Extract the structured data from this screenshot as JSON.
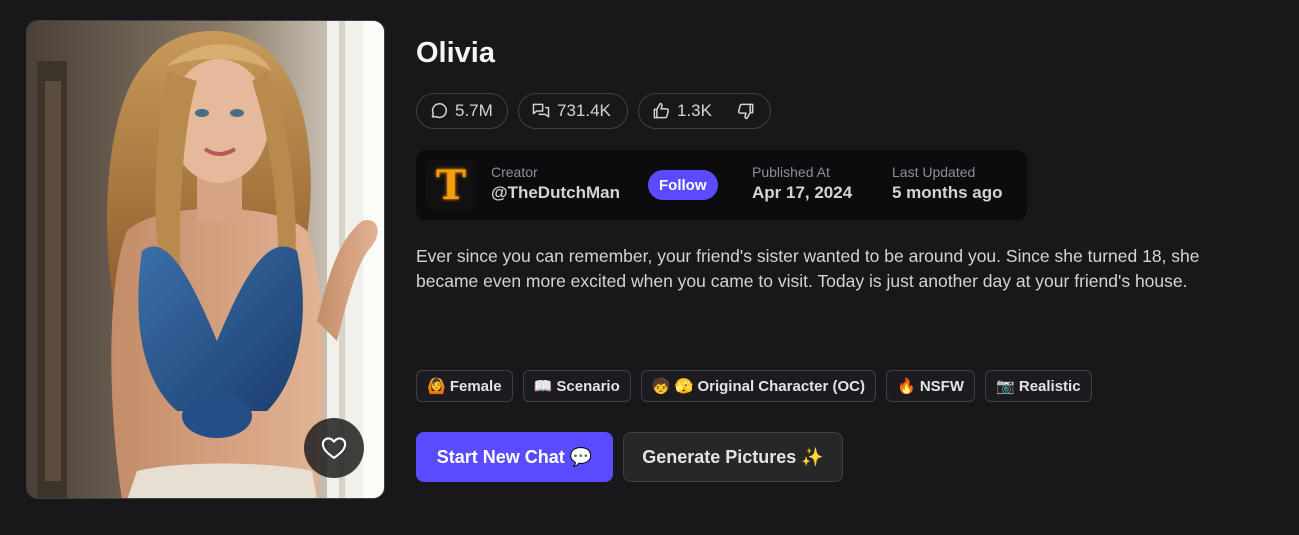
{
  "character": {
    "name": "Olivia",
    "image_alt": "character portrait"
  },
  "stats": {
    "messages": "5.7M",
    "chats": "731.4K",
    "likes": "1.3K"
  },
  "creator": {
    "label": "Creator",
    "handle": "@TheDutchMan",
    "avatar_letter": "T",
    "follow_label": "Follow"
  },
  "published": {
    "label": "Published At",
    "value": "Apr 17, 2024"
  },
  "updated": {
    "label": "Last Updated",
    "value": "5 months ago"
  },
  "description": "Ever since you can remember, your friend's sister wanted to be around you. Since she turned 18, she became even more excited when you came to visit. Today is just another day at your friend's house.",
  "tags": [
    {
      "label": "🙆 Female"
    },
    {
      "label": "📖 Scenario"
    },
    {
      "label": "🧒 🫣 Original Character (OC)"
    },
    {
      "label": "🔥 NSFW"
    },
    {
      "label": "📷 Realistic"
    }
  ],
  "actions": {
    "start_chat": "Start New Chat 💬",
    "generate": "Generate Pictures ✨"
  },
  "colors": {
    "background": "#18181b",
    "accent": "#5b4bff",
    "creator_panel": "#0c0c0e"
  },
  "icons": {
    "messages": "message-circle-icon",
    "chats": "messages-square-icon",
    "like": "thumbs-up-icon",
    "dislike": "thumbs-down-icon",
    "favorite": "heart-icon"
  }
}
